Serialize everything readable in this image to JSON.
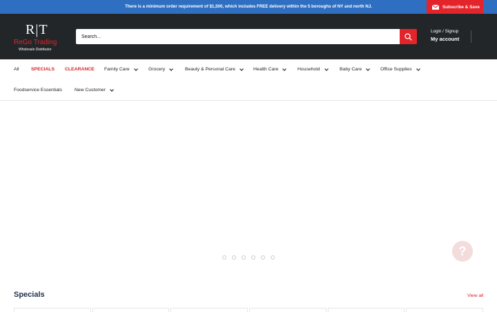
{
  "announcement": "There is a minimum order requirement of $1,500, which includes FREE delivery within the 5 boroughs of NY and north NJ.",
  "subscribe_label": "Subscribe & Save",
  "logo": {
    "mark": "R|T",
    "name": "ReGo Trading",
    "tagline": "Wholesale Distributor"
  },
  "search": {
    "placeholder": "Search..."
  },
  "account": {
    "login": "Login / Signup",
    "my_account": "My account"
  },
  "nav": [
    {
      "label": "All"
    },
    {
      "label": "SPECIALS"
    },
    {
      "label": "CLEARANCE"
    },
    {
      "label": "Family Care"
    },
    {
      "label": "Grocery"
    },
    {
      "label": "Beauty & Personal Care"
    },
    {
      "label": "Health Care"
    },
    {
      "label": "Household"
    },
    {
      "label": "Baby Care"
    },
    {
      "label": "Office Supplies"
    },
    {
      "label": "Foodservice Essentials"
    },
    {
      "label": "New Customer"
    }
  ],
  "help_label": "?",
  "specials": {
    "title": "Specials",
    "view_all": "View all"
  },
  "colors": {
    "brand_red": "#e3242b",
    "header_bg": "#222629",
    "announce_bg": "#2f6fc1"
  }
}
